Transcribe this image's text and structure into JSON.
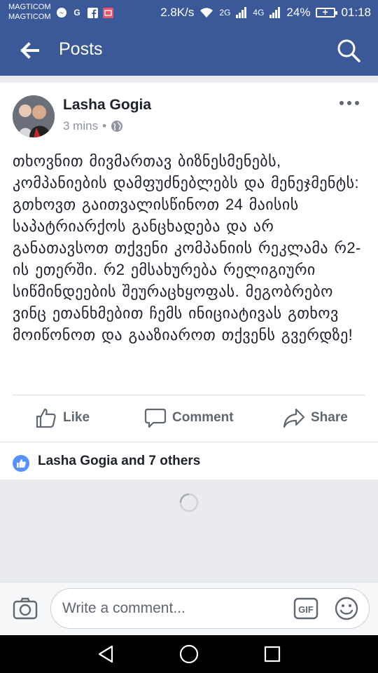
{
  "status_bar": {
    "carrier_1": "MAGTICOM",
    "carrier_2": "MAGTICOM",
    "speed": "2.8K/s",
    "network_1": "2G",
    "network_2": "4G",
    "battery": "24%",
    "time": "01:18"
  },
  "app_bar": {
    "title": "Posts"
  },
  "post": {
    "author": "Lasha Gogia",
    "time": "3 mins",
    "separator": "•",
    "text": "თხოვნით მივმართავ ბიზნესმენებს, კომპანიების დამფუძნებლებს და მენეჯმენტს: გთხოვთ გაითვალისწინოთ 24 მაისის საპატრიარქოს განცხადება და არ განათავსოთ თქვენი კომპანიის რეკლამა რ2-ის ეთერში. რ2 ემსახურება რელიგიური სიწმინდეების შეურაცხყოფას. მეგობრებო ვინც ეთანხმებით ჩემს ინიციატივას გთხოვ მოიწონოთ და გააზიაროთ თქვენს გვერდზე!"
  },
  "actions": {
    "like_label": "Like",
    "comment_label": "Comment",
    "share_label": "Share"
  },
  "reactions": {
    "text": "Lasha Gogia and 7 others"
  },
  "composer": {
    "placeholder": "Write a comment..."
  },
  "colors": {
    "brand": "#3b5998",
    "like_blue": "#5890ff",
    "text": "#1d2129",
    "muted": "#90949c"
  },
  "icons": [
    "back-arrow-icon",
    "search-icon",
    "more-icon",
    "globe-icon",
    "like-icon",
    "comment-icon",
    "share-icon",
    "camera-icon",
    "gif-icon",
    "emoji-icon",
    "loading-spinner"
  ]
}
